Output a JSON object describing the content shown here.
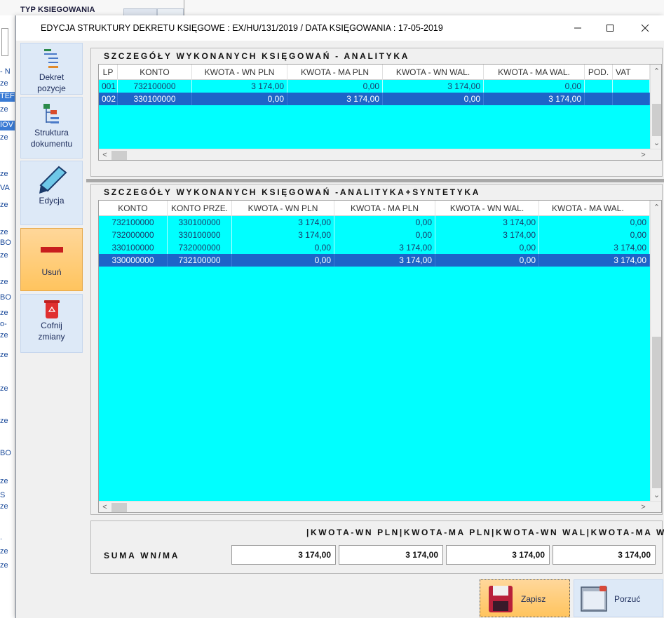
{
  "background": {
    "label": "TYP KSIEGOWANIA",
    "fragments": [
      "- N",
      "ze",
      "TEF",
      "ze",
      "IOV",
      "ze",
      "ze",
      "VA",
      "ze",
      "ze",
      "BO",
      "ze",
      "ze",
      "BO",
      "ze",
      "o-",
      "ze",
      "ze",
      "ze",
      "ze",
      "BO",
      "ze",
      "S",
      "ze",
      ".",
      "ze",
      "ze"
    ]
  },
  "window": {
    "title": "EDYCJA STRUKTURY DEKRETU KSIĘGOWE : EX/HU/131/2019 / DATA KSIĘGOWANIA : 17-05-2019"
  },
  "toolbar": {
    "items": [
      {
        "label1": "Dekret",
        "label2": "pozycje"
      },
      {
        "label1": "Struktura",
        "label2": "dokumentu"
      },
      {
        "label1": "Edycja",
        "label2": ""
      },
      {
        "label1": "Usuń",
        "label2": ""
      },
      {
        "label1": "Cofnij",
        "label2": "zmiany"
      }
    ]
  },
  "analityka": {
    "title": "SZCZEGÓŁY WYKONANYCH KSIĘGOWAŃ - ANALITYKA",
    "columns": [
      "LP",
      "KONTO",
      "KWOTA - WN PLN",
      "KWOTA - MA PLN",
      "KWOTA - WN WAL.",
      "KWOTA - MA WAL.",
      "POD.",
      "VAT"
    ],
    "rows": [
      {
        "cells": [
          "001",
          "732100000",
          "3 174,00",
          "0,00",
          "3 174,00",
          "0,00",
          "",
          ""
        ],
        "selected": false
      },
      {
        "cells": [
          "002",
          "330100000",
          "0,00",
          "3 174,00",
          "0,00",
          "3 174,00",
          "",
          ""
        ],
        "selected": true
      }
    ]
  },
  "syntetyka": {
    "title": "SZCZEGÓŁY WYKONANYCH KSIĘGOWAŃ -ANALITYKA+SYNTETYKA",
    "columns": [
      "KONTO",
      "KONTO PRZE.",
      "KWOTA - WN PLN",
      "KWOTA - MA PLN",
      "KWOTA - WN WAL.",
      "KWOTA - MA WAL."
    ],
    "rows": [
      {
        "cells": [
          "732100000",
          "330100000",
          "3 174,00",
          "0,00",
          "3 174,00",
          "0,00"
        ],
        "selected": false
      },
      {
        "cells": [
          "732000000",
          "330100000",
          "3 174,00",
          "0,00",
          "3 174,00",
          "0,00"
        ],
        "selected": false
      },
      {
        "cells": [
          "330100000",
          "732000000",
          "0,00",
          "3 174,00",
          "0,00",
          "3 174,00"
        ],
        "selected": false
      },
      {
        "cells": [
          "330000000",
          "732100000",
          "0,00",
          "3 174,00",
          "0,00",
          "3 174,00"
        ],
        "selected": true
      }
    ]
  },
  "suma": {
    "header": "|KWOTA-WN PLN|KWOTA-MA PLN|KWOTA-WN WAL|KWOTA-MA WAL|",
    "label": "SUMA WN/MA",
    "values": [
      "3 174,00",
      "3 174,00",
      "3 174,00",
      "3 174,00"
    ]
  },
  "buttons": {
    "save": "Zapisz",
    "discard": "Porzuć"
  },
  "colors": {
    "grid_bg": "#00ffff",
    "selected_row": "#1e64c8",
    "save_button": "#ffc45e"
  }
}
